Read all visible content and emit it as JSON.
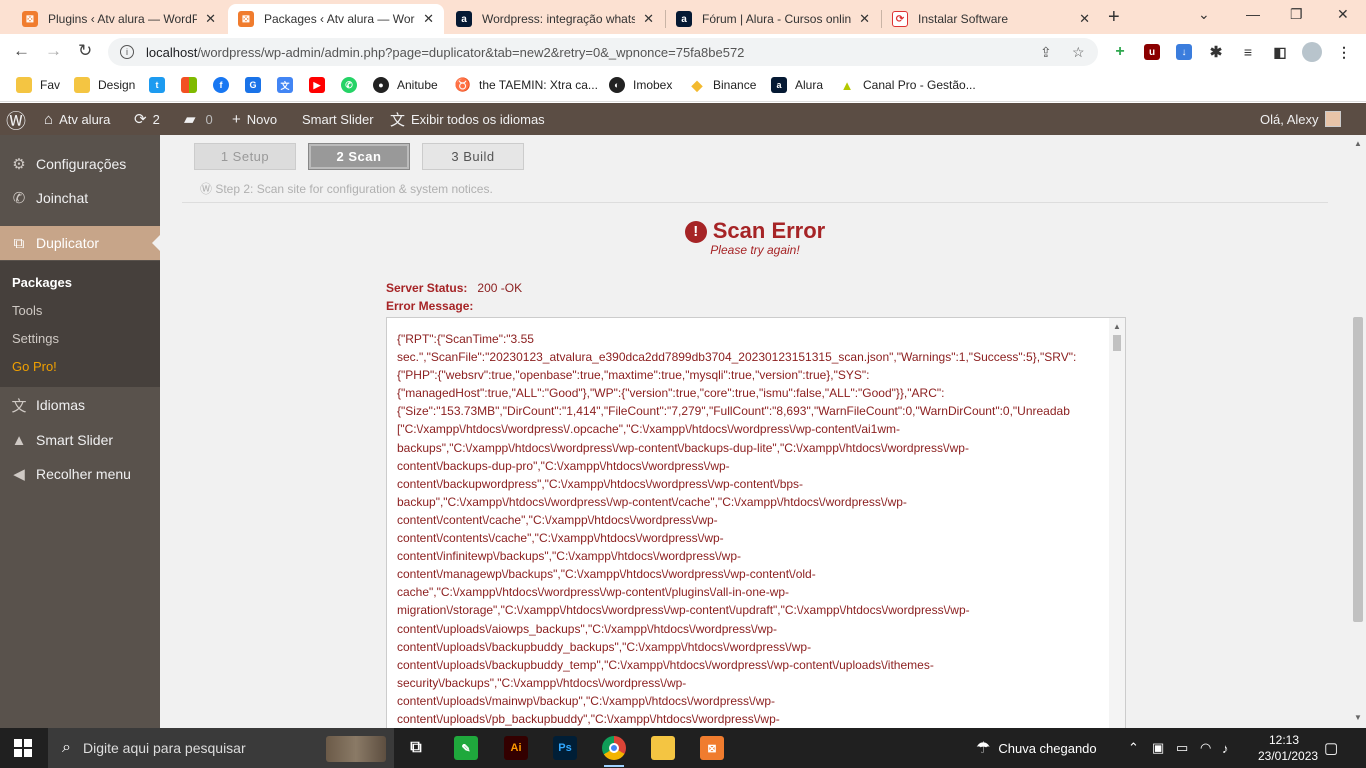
{
  "browser": {
    "tabs": [
      {
        "title": "Plugins ‹ Atv alura — WordPress",
        "favicon": "xampp-icon"
      },
      {
        "title": "Packages ‹ Atv alura — WordPress",
        "favicon": "xampp-icon"
      },
      {
        "title": "Wordpress: integração whatsapp",
        "favicon": "alura-icon"
      },
      {
        "title": "Fórum | Alura - Cursos online",
        "favicon": "alura-icon"
      },
      {
        "title": "Instalar Software",
        "favicon": "software-icon"
      }
    ],
    "url_host": "localhost",
    "url_path": "/wordpress/wp-admin/admin.php?page=duplicator&tab=new2&retry=0&_wpnonce=75fa8be572",
    "bookmarks": [
      "Fav",
      "Design",
      "",
      "",
      "",
      "",
      "",
      "",
      "Anitube",
      "the TAEMIN: Xtra ca...",
      "Imobex",
      "Binance",
      "Alura",
      "Canal Pro - Gestão..."
    ]
  },
  "adminbar": {
    "site_name": "Atv alura",
    "updates_count": "2",
    "comments_count": "0",
    "new_label": "Novo",
    "smart_slider": "Smart Slider",
    "languages": "Exibir todos os idiomas",
    "greeting": "Olá, Alexy"
  },
  "sidebar": {
    "items": [
      {
        "label": "Configurações",
        "icon": "sliders-icon"
      },
      {
        "label": "Joinchat",
        "icon": "whatsapp-icon"
      },
      {
        "label": "Duplicator",
        "icon": "duplicator-icon"
      },
      {
        "label": "Idiomas",
        "icon": "translate-icon"
      },
      {
        "label": "Smart Slider",
        "icon": "graduation-cap-icon"
      },
      {
        "label": "Recolher menu",
        "icon": "collapse-icon"
      }
    ],
    "submenu": [
      "Packages",
      "Tools",
      "Settings",
      "Go Pro!"
    ]
  },
  "steps": {
    "step1": "1 Setup",
    "step2": "2 Scan",
    "step3": "3 Build",
    "note": "Step 2: Scan site for configuration & system notices."
  },
  "error": {
    "title": "Scan Error",
    "subtitle": "Please try again!",
    "server_status_label": "Server Status:",
    "server_status_value": "200 -OK",
    "message_label": "Error Message:",
    "message_lines": [
      "{\"RPT\":{\"ScanTime\":\"3.55",
      "sec.\",\"ScanFile\":\"20230123_atvalura_e390dca2dd7899db3704_20230123151315_scan.json\",\"Warnings\":1,\"Success\":5},\"SRV\":",
      "{\"PHP\":{\"websrv\":true,\"openbase\":true,\"maxtime\":true,\"mysqli\":true,\"version\":true},\"SYS\":",
      "{\"managedHost\":true,\"ALL\":\"Good\"},\"WP\":{\"version\":true,\"core\":true,\"ismu\":false,\"ALL\":\"Good\"}},\"ARC\":",
      "{\"Size\":\"153.73MB\",\"DirCount\":\"1,414\",\"FileCount\":\"7,279\",\"FullCount\":\"8,693\",\"WarnFileCount\":0,\"WarnDirCount\":0,\"Unreadab",
      "[\"C:\\/xampp\\/htdocs\\/wordpress\\/.opcache\",\"C:\\/xampp\\/htdocs\\/wordpress\\/wp-content\\/ai1wm-",
      "backups\",\"C:\\/xampp\\/htdocs\\/wordpress\\/wp-content\\/backups-dup-lite\",\"C:\\/xampp\\/htdocs\\/wordpress\\/wp-",
      "content\\/backups-dup-pro\",\"C:\\/xampp\\/htdocs\\/wordpress\\/wp-",
      "content\\/backupwordpress\",\"C:\\/xampp\\/htdocs\\/wordpress\\/wp-content\\/bps-",
      "backup\",\"C:\\/xampp\\/htdocs\\/wordpress\\/wp-content\\/cache\",\"C:\\/xampp\\/htdocs\\/wordpress\\/wp-",
      "content\\/content\\/cache\",\"C:\\/xampp\\/htdocs\\/wordpress\\/wp-",
      "content\\/contents\\/cache\",\"C:\\/xampp\\/htdocs\\/wordpress\\/wp-",
      "content\\/infinitewp\\/backups\",\"C:\\/xampp\\/htdocs\\/wordpress\\/wp-",
      "content\\/managewp\\/backups\",\"C:\\/xampp\\/htdocs\\/wordpress\\/wp-content\\/old-",
      "cache\",\"C:\\/xampp\\/htdocs\\/wordpress\\/wp-content\\/plugins\\/all-in-one-wp-",
      "migration\\/storage\",\"C:\\/xampp\\/htdocs\\/wordpress\\/wp-content\\/updraft\",\"C:\\/xampp\\/htdocs\\/wordpress\\/wp-",
      "content\\/uploads\\/aiowps_backups\",\"C:\\/xampp\\/htdocs\\/wordpress\\/wp-",
      "content\\/uploads\\/backupbuddy_backups\",\"C:\\/xampp\\/htdocs\\/wordpress\\/wp-",
      "content\\/uploads\\/backupbuddy_temp\",\"C:\\/xampp\\/htdocs\\/wordpress\\/wp-content\\/uploads\\/ithemes-",
      "security\\/backups\",\"C:\\/xampp\\/htdocs\\/wordpress\\/wp-",
      "content\\/uploads\\/mainwp\\/backup\",\"C:\\/xampp\\/htdocs\\/wordpress\\/wp-",
      "content\\/uploads\\/pb_backupbuddy\",\"C:\\/xampp\\/htdocs\\/wordpress\\/wp-"
    ]
  },
  "taskbar": {
    "search_placeholder": "Digite aqui para pesquisar",
    "weather": "Chuva chegando",
    "time": "12:13",
    "date": "23/01/2023"
  },
  "colors": {
    "admin_bar": "#5b4d44",
    "sidebar": "#59524c",
    "accent": "#c7a589",
    "error_red": "#a62426"
  }
}
